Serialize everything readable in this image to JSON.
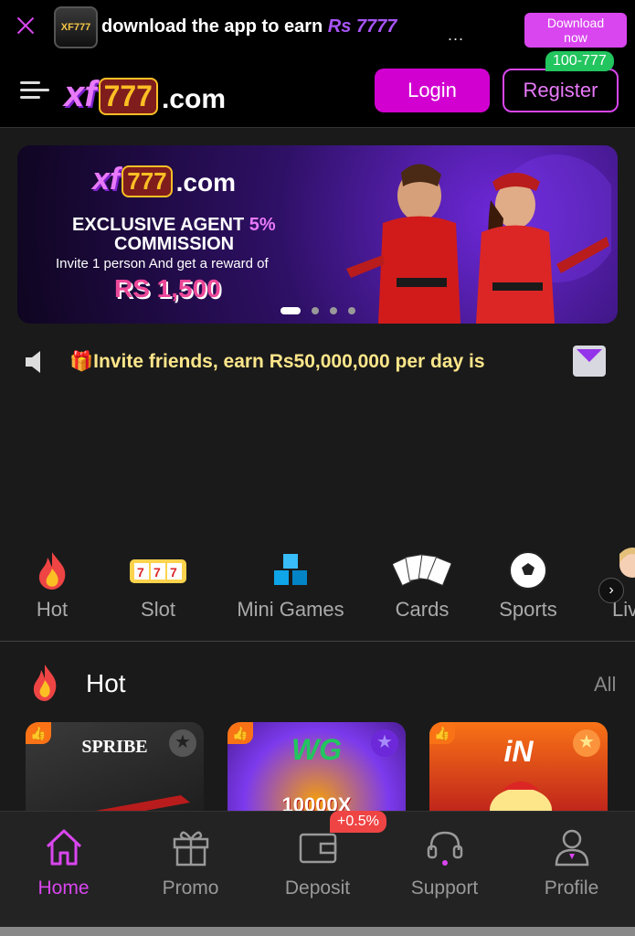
{
  "app_banner": {
    "logo_text": "XF777",
    "text": "download the app to earn ",
    "amount": "Rs 7777",
    "more": "...",
    "download_line1": "Download",
    "download_line2": "now"
  },
  "header": {
    "brand_xf": "xf",
    "brand_777": "777",
    "brand_com": ".com",
    "login_label": "Login",
    "register_label": "Register",
    "register_badge": "100-777"
  },
  "hero": {
    "brand_xf": "xf",
    "brand_777": "777",
    "brand_com": ".com",
    "line1": "EXCLUSIVE AGENT ",
    "line1_pct": "5%",
    "line2": "COMMISSION",
    "line3": "Invite 1 person And get a reward of",
    "line4": "RS 1,500",
    "slides": 4,
    "active_slide": 1
  },
  "marquee": {
    "text": "🎁Invite friends, earn Rs50,000,000  per day is"
  },
  "categories": [
    {
      "label": "Hot",
      "icon": "flame-icon"
    },
    {
      "label": "Slot",
      "icon": "slot-machine-icon"
    },
    {
      "label": "Mini Games",
      "icon": "cubes-icon"
    },
    {
      "label": "Cards",
      "icon": "cards-icon"
    },
    {
      "label": "Sports",
      "icon": "soccer-ball-icon"
    },
    {
      "label": "Live",
      "icon": "live-dealer-icon"
    }
  ],
  "hot_section": {
    "title": "Hot",
    "all_label": "All",
    "games": [
      {
        "name": "SPRIBE"
      },
      {
        "name": "WG",
        "sub": "10000X"
      },
      {
        "name": "iN"
      }
    ]
  },
  "bottom_nav": {
    "items": [
      {
        "label": "Home"
      },
      {
        "label": "Promo"
      },
      {
        "label": "Deposit"
      },
      {
        "label": "Support"
      },
      {
        "label": "Profile"
      }
    ],
    "deposit_badge": "+0.5%"
  },
  "colors": {
    "accent": "#d946ef",
    "login_bg": "#d100d1",
    "badge_green": "#22c55e",
    "badge_red": "#ef4444",
    "marquee_text": "#fde68a"
  }
}
